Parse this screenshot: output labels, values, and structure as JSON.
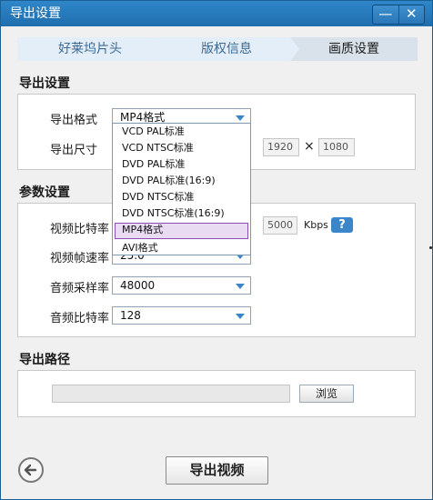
{
  "window": {
    "title": "导出设置",
    "min_symbol": "—",
    "close_symbol": "✕"
  },
  "steps": [
    "好莱坞片头",
    "版权信息",
    "画质设置"
  ],
  "export_section": {
    "title": "导出设置",
    "format_label": "导出格式",
    "format_value": "MP4格式",
    "size_label": "导出尺寸",
    "width": "1920",
    "times": "×",
    "height": "1080"
  },
  "format_options": [
    "VCD PAL标准",
    "VCD NTSC标准",
    "DVD PAL标准",
    "DVD PAL标准(16:9)",
    "DVD NTSC标准",
    "DVD NTSC标准(16:9)",
    "MP4格式",
    "AVI格式"
  ],
  "selected_option_index": 6,
  "params_section": {
    "title": "参数设置",
    "video_bitrate_label": "视频比特率",
    "video_bitrate": "5000",
    "bitrate_unit": "Kbps",
    "help": "?",
    "framerate_label": "视频帧速率",
    "framerate_value": "25.0",
    "audio_samplerate_label": "音频采样率",
    "audio_samplerate_value": "48000",
    "audio_bitrate_label": "音频比特率",
    "audio_bitrate_value": "128"
  },
  "path_section": {
    "title": "导出路径",
    "path_value": "",
    "browse_label": "浏览"
  },
  "export_button": "导出视频",
  "colors": {
    "title_bar": "#1f6eae",
    "accent": "#3a86c9",
    "selected_border": "#8a4eb5"
  }
}
